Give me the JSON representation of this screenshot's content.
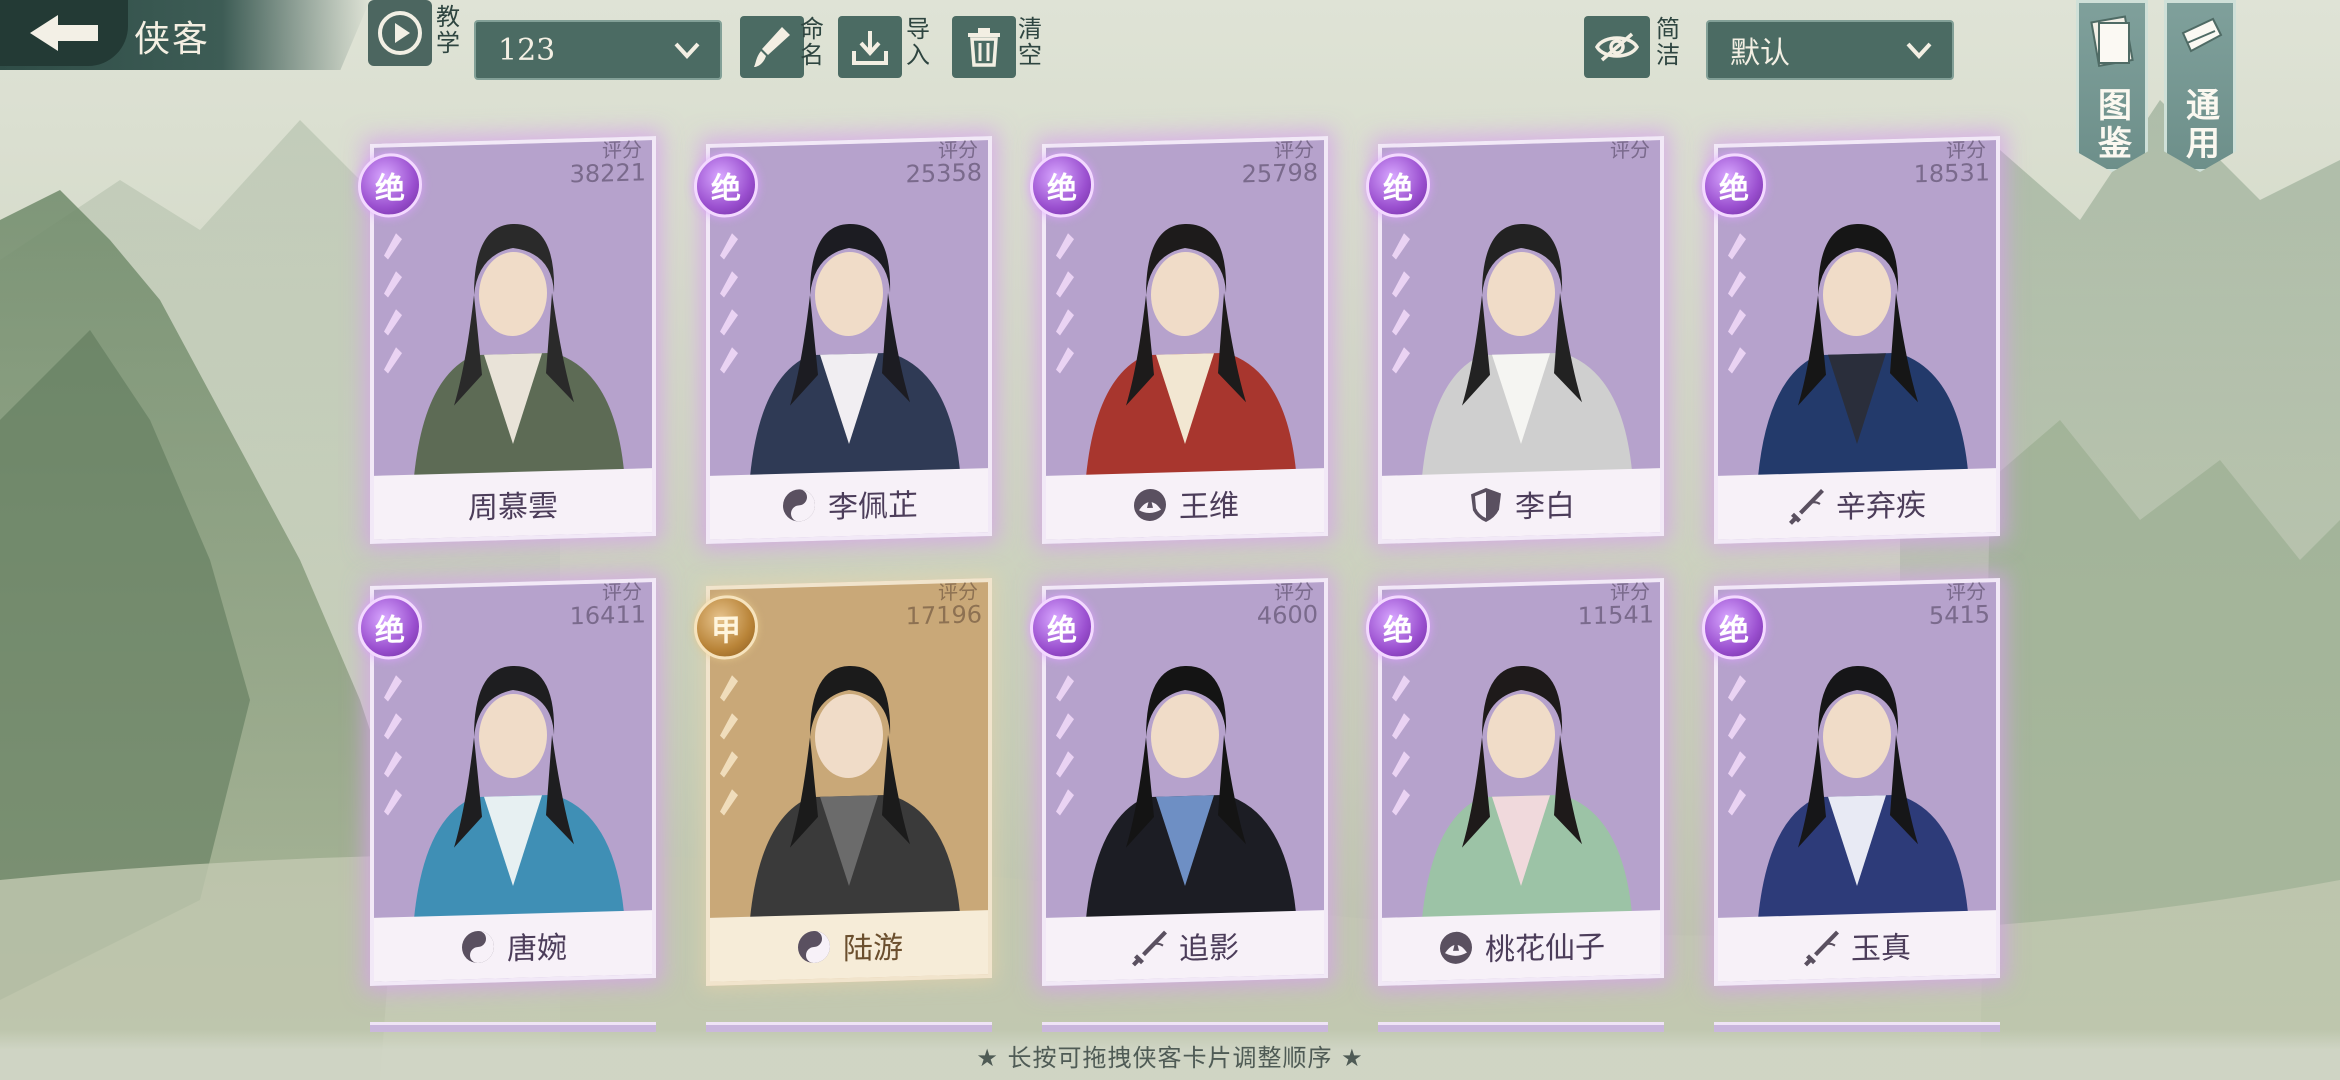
{
  "header": {
    "title": "侠客",
    "tutorial_label": "教学",
    "team_select_value": "123",
    "rename_label": "命名",
    "import_label": "导入",
    "clear_label": "清空",
    "simple_label": "简洁",
    "sort_select_value": "默认"
  },
  "side_tabs": [
    {
      "label": "图鉴",
      "icon": "book-icon"
    },
    {
      "label": "通用",
      "icon": "scroll-icon"
    }
  ],
  "cards": [
    {
      "grade": "绝",
      "score_label": "评分",
      "score": "38221",
      "name": "周慕雲",
      "school_icon": "",
      "tier": "purple"
    },
    {
      "grade": "绝",
      "score_label": "评分",
      "score": "25358",
      "name": "李佩芷",
      "school_icon": "yin-yang-icon",
      "tier": "purple"
    },
    {
      "grade": "绝",
      "score_label": "评分",
      "score": "25798",
      "name": "王维",
      "school_icon": "lotus-icon",
      "tier": "purple"
    },
    {
      "grade": "绝",
      "score_label": "评分",
      "score": "",
      "name": "李白",
      "school_icon": "shield-icon",
      "tier": "purple"
    },
    {
      "grade": "绝",
      "score_label": "评分",
      "score": "18531",
      "name": "辛弃疾",
      "school_icon": "sword-icon",
      "tier": "purple"
    },
    {
      "grade": "绝",
      "score_label": "评分",
      "score": "16411",
      "name": "唐婉",
      "school_icon": "yin-yang-icon",
      "tier": "purple"
    },
    {
      "grade": "甲",
      "score_label": "评分",
      "score": "17196",
      "name": "陆游",
      "school_icon": "yin-yang-icon",
      "tier": "gold"
    },
    {
      "grade": "绝",
      "score_label": "评分",
      "score": "4600",
      "name": "追影",
      "school_icon": "sword-icon",
      "tier": "purple"
    },
    {
      "grade": "绝",
      "score_label": "评分",
      "score": "11541",
      "name": "桃花仙子",
      "school_icon": "lotus-icon",
      "tier": "purple"
    },
    {
      "grade": "绝",
      "score_label": "评分",
      "score": "5415",
      "name": "玉真",
      "school_icon": "sword-icon",
      "tier": "purple"
    }
  ],
  "footer": {
    "hint": "★ 长按可拖拽侠客卡片调整顺序 ★"
  },
  "colors": {
    "accent_teal": "#4b6b63",
    "purple_card": "#b9a5cf",
    "gold_card": "#d4b690"
  }
}
